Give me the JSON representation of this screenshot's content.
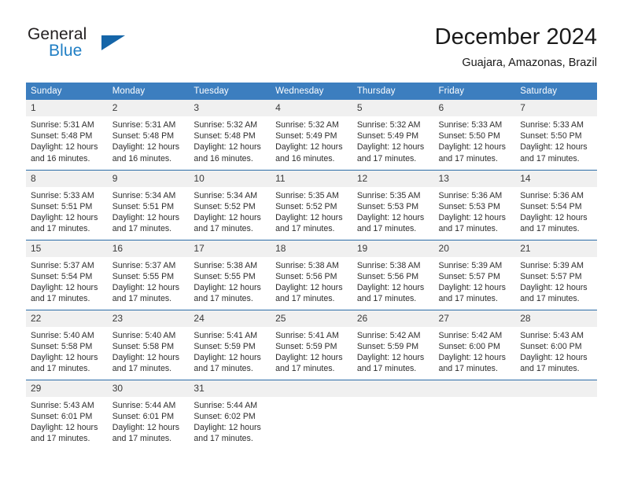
{
  "brand": {
    "name_part1": "General",
    "name_part2": "Blue",
    "triangle_color": "#1565a8",
    "blue_color": "#1f7ec4"
  },
  "header": {
    "title": "December 2024",
    "subtitle": "Guajara, Amazonas, Brazil"
  },
  "theme": {
    "header_bg": "#3c7ebf",
    "row_separator": "#2b6ca8",
    "daynum_bg": "#f0f0f0"
  },
  "calendar": {
    "weekday_headers": [
      "Sunday",
      "Monday",
      "Tuesday",
      "Wednesday",
      "Thursday",
      "Friday",
      "Saturday"
    ],
    "weeks": [
      [
        {
          "day": "1",
          "sunrise": "Sunrise: 5:31 AM",
          "sunset": "Sunset: 5:48 PM",
          "daylight": "Daylight: 12 hours and 16 minutes."
        },
        {
          "day": "2",
          "sunrise": "Sunrise: 5:31 AM",
          "sunset": "Sunset: 5:48 PM",
          "daylight": "Daylight: 12 hours and 16 minutes."
        },
        {
          "day": "3",
          "sunrise": "Sunrise: 5:32 AM",
          "sunset": "Sunset: 5:48 PM",
          "daylight": "Daylight: 12 hours and 16 minutes."
        },
        {
          "day": "4",
          "sunrise": "Sunrise: 5:32 AM",
          "sunset": "Sunset: 5:49 PM",
          "daylight": "Daylight: 12 hours and 16 minutes."
        },
        {
          "day": "5",
          "sunrise": "Sunrise: 5:32 AM",
          "sunset": "Sunset: 5:49 PM",
          "daylight": "Daylight: 12 hours and 17 minutes."
        },
        {
          "day": "6",
          "sunrise": "Sunrise: 5:33 AM",
          "sunset": "Sunset: 5:50 PM",
          "daylight": "Daylight: 12 hours and 17 minutes."
        },
        {
          "day": "7",
          "sunrise": "Sunrise: 5:33 AM",
          "sunset": "Sunset: 5:50 PM",
          "daylight": "Daylight: 12 hours and 17 minutes."
        }
      ],
      [
        {
          "day": "8",
          "sunrise": "Sunrise: 5:33 AM",
          "sunset": "Sunset: 5:51 PM",
          "daylight": "Daylight: 12 hours and 17 minutes."
        },
        {
          "day": "9",
          "sunrise": "Sunrise: 5:34 AM",
          "sunset": "Sunset: 5:51 PM",
          "daylight": "Daylight: 12 hours and 17 minutes."
        },
        {
          "day": "10",
          "sunrise": "Sunrise: 5:34 AM",
          "sunset": "Sunset: 5:52 PM",
          "daylight": "Daylight: 12 hours and 17 minutes."
        },
        {
          "day": "11",
          "sunrise": "Sunrise: 5:35 AM",
          "sunset": "Sunset: 5:52 PM",
          "daylight": "Daylight: 12 hours and 17 minutes."
        },
        {
          "day": "12",
          "sunrise": "Sunrise: 5:35 AM",
          "sunset": "Sunset: 5:53 PM",
          "daylight": "Daylight: 12 hours and 17 minutes."
        },
        {
          "day": "13",
          "sunrise": "Sunrise: 5:36 AM",
          "sunset": "Sunset: 5:53 PM",
          "daylight": "Daylight: 12 hours and 17 minutes."
        },
        {
          "day": "14",
          "sunrise": "Sunrise: 5:36 AM",
          "sunset": "Sunset: 5:54 PM",
          "daylight": "Daylight: 12 hours and 17 minutes."
        }
      ],
      [
        {
          "day": "15",
          "sunrise": "Sunrise: 5:37 AM",
          "sunset": "Sunset: 5:54 PM",
          "daylight": "Daylight: 12 hours and 17 minutes."
        },
        {
          "day": "16",
          "sunrise": "Sunrise: 5:37 AM",
          "sunset": "Sunset: 5:55 PM",
          "daylight": "Daylight: 12 hours and 17 minutes."
        },
        {
          "day": "17",
          "sunrise": "Sunrise: 5:38 AM",
          "sunset": "Sunset: 5:55 PM",
          "daylight": "Daylight: 12 hours and 17 minutes."
        },
        {
          "day": "18",
          "sunrise": "Sunrise: 5:38 AM",
          "sunset": "Sunset: 5:56 PM",
          "daylight": "Daylight: 12 hours and 17 minutes."
        },
        {
          "day": "19",
          "sunrise": "Sunrise: 5:38 AM",
          "sunset": "Sunset: 5:56 PM",
          "daylight": "Daylight: 12 hours and 17 minutes."
        },
        {
          "day": "20",
          "sunrise": "Sunrise: 5:39 AM",
          "sunset": "Sunset: 5:57 PM",
          "daylight": "Daylight: 12 hours and 17 minutes."
        },
        {
          "day": "21",
          "sunrise": "Sunrise: 5:39 AM",
          "sunset": "Sunset: 5:57 PM",
          "daylight": "Daylight: 12 hours and 17 minutes."
        }
      ],
      [
        {
          "day": "22",
          "sunrise": "Sunrise: 5:40 AM",
          "sunset": "Sunset: 5:58 PM",
          "daylight": "Daylight: 12 hours and 17 minutes."
        },
        {
          "day": "23",
          "sunrise": "Sunrise: 5:40 AM",
          "sunset": "Sunset: 5:58 PM",
          "daylight": "Daylight: 12 hours and 17 minutes."
        },
        {
          "day": "24",
          "sunrise": "Sunrise: 5:41 AM",
          "sunset": "Sunset: 5:59 PM",
          "daylight": "Daylight: 12 hours and 17 minutes."
        },
        {
          "day": "25",
          "sunrise": "Sunrise: 5:41 AM",
          "sunset": "Sunset: 5:59 PM",
          "daylight": "Daylight: 12 hours and 17 minutes."
        },
        {
          "day": "26",
          "sunrise": "Sunrise: 5:42 AM",
          "sunset": "Sunset: 5:59 PM",
          "daylight": "Daylight: 12 hours and 17 minutes."
        },
        {
          "day": "27",
          "sunrise": "Sunrise: 5:42 AM",
          "sunset": "Sunset: 6:00 PM",
          "daylight": "Daylight: 12 hours and 17 minutes."
        },
        {
          "day": "28",
          "sunrise": "Sunrise: 5:43 AM",
          "sunset": "Sunset: 6:00 PM",
          "daylight": "Daylight: 12 hours and 17 minutes."
        }
      ],
      [
        {
          "day": "29",
          "sunrise": "Sunrise: 5:43 AM",
          "sunset": "Sunset: 6:01 PM",
          "daylight": "Daylight: 12 hours and 17 minutes."
        },
        {
          "day": "30",
          "sunrise": "Sunrise: 5:44 AM",
          "sunset": "Sunset: 6:01 PM",
          "daylight": "Daylight: 12 hours and 17 minutes."
        },
        {
          "day": "31",
          "sunrise": "Sunrise: 5:44 AM",
          "sunset": "Sunset: 6:02 PM",
          "daylight": "Daylight: 12 hours and 17 minutes."
        },
        {
          "day": "",
          "sunrise": "",
          "sunset": "",
          "daylight": ""
        },
        {
          "day": "",
          "sunrise": "",
          "sunset": "",
          "daylight": ""
        },
        {
          "day": "",
          "sunrise": "",
          "sunset": "",
          "daylight": ""
        },
        {
          "day": "",
          "sunrise": "",
          "sunset": "",
          "daylight": ""
        }
      ]
    ]
  }
}
